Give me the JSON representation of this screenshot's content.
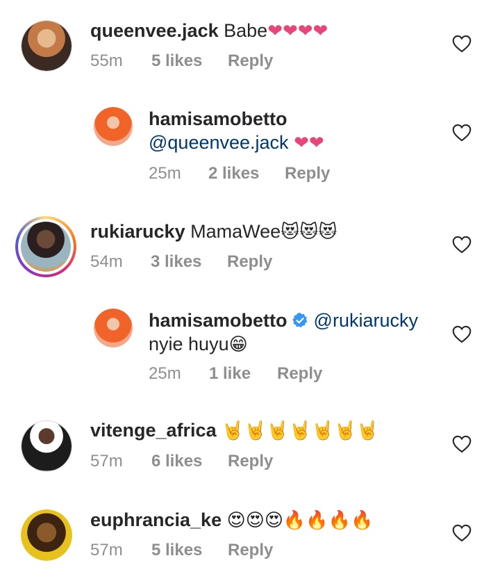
{
  "comments": [
    {
      "username": "queenvee.jack",
      "text": "Babe",
      "emojis": "❤❤❤❤",
      "time": "55m",
      "likes": "5 likes",
      "reply": "Reply"
    },
    {
      "username": "hamisamobetto",
      "mention": "@queenvee.jack",
      "emojis": "❤❤",
      "time": "25m",
      "likes": "2 likes",
      "reply": "Reply"
    },
    {
      "username": "rukiarucky",
      "text": "MamaWee",
      "emojis": "😻😻😻",
      "time": "54m",
      "likes": "3 likes",
      "reply": "Reply"
    },
    {
      "username": "hamisamobetto",
      "mention": "@rukiarucky",
      "text": "nyie huyu",
      "emojis": "😁",
      "time": "25m",
      "likes": "1 like",
      "reply": "Reply"
    },
    {
      "username": "vitenge_africa",
      "emojis": "🤘🤘🤘🤘🤘🤘🤘",
      "time": "57m",
      "likes": "6 likes",
      "reply": "Reply"
    },
    {
      "username": "euphrancia_ke",
      "emojis": "😍😍😍🔥🔥🔥🔥",
      "time": "57m",
      "likes": "5 likes",
      "reply": "Reply"
    }
  ],
  "colors": {
    "text": "#262626",
    "meta": "#8e8e8e",
    "mention": "#00376b",
    "heart_emoji": "#e8457a",
    "verified": "#3897f0"
  },
  "icons": [
    "heart-outline-icon",
    "verified-badge-icon"
  ]
}
